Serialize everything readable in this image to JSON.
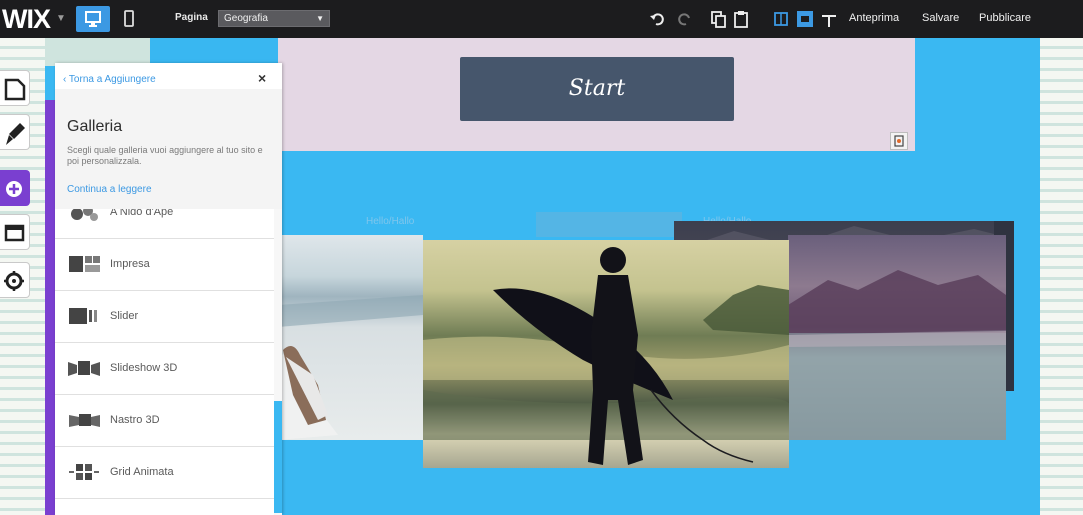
{
  "topbar": {
    "logo": "WIX",
    "page_label": "Pagina",
    "page_value": "Geografia",
    "preview": "Anteprima",
    "save": "Salvare",
    "publish": "Pubblicare"
  },
  "canvas": {
    "start_button": "Start",
    "hint_left": "Hello/Hallo",
    "hint_right": "Hello/Hallo"
  },
  "panel": {
    "back": "‹ Torna a Aggiungere",
    "close": "×",
    "title": "Galleria",
    "description": "Scegli quale galleria vuoi aggiungere al tuo sito e poi personalizzala.",
    "more": "Continua a leggere",
    "items": [
      {
        "label": "A Nido d'Ape"
      },
      {
        "label": "Impresa"
      },
      {
        "label": "Slider"
      },
      {
        "label": "Slideshow 3D"
      },
      {
        "label": "Nastro 3D"
      },
      {
        "label": "Grid Animata"
      }
    ]
  },
  "colors": {
    "accent_blue": "#3c99e3",
    "canvas_blue": "#3ab8f2",
    "panel_purple": "#7a3fd0",
    "start_button": "#46566c"
  }
}
